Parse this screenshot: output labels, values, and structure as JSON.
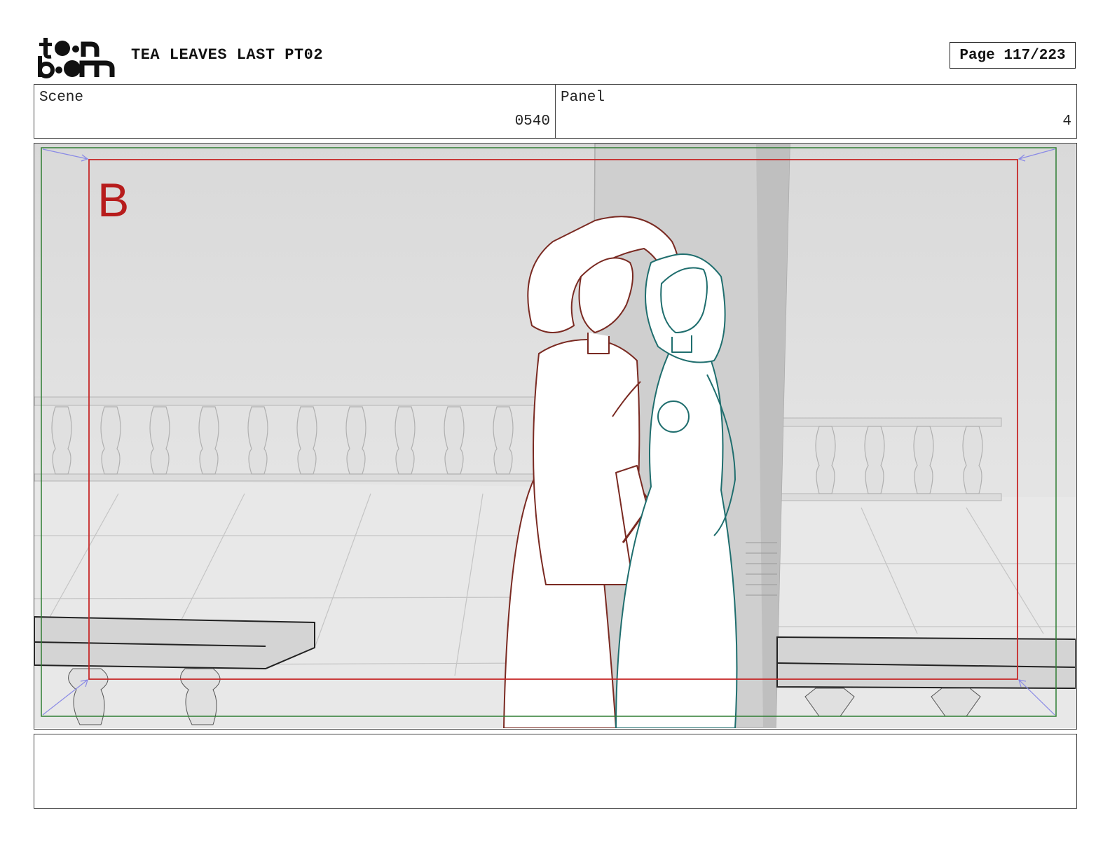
{
  "header": {
    "logo_alt": "toon boom",
    "project_title": "TEA LEAVES LAST PT02",
    "page_label": "Page 117/223"
  },
  "info": {
    "scene_label": "Scene",
    "scene_value": "0540",
    "panel_label": "Panel",
    "panel_value": "4"
  },
  "frame": {
    "safe_area_marker": "B",
    "colors": {
      "outer_guide": "#2e7d32",
      "inner_guide": "#c62828",
      "corner_arrows": "#8a8ae6",
      "character_left": "#7a2a22",
      "character_right": "#1f6e6e",
      "background": "#e4e4e4"
    }
  },
  "notes": {
    "text": ""
  }
}
